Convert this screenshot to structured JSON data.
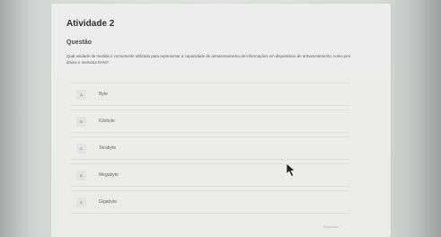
{
  "page": {
    "title": "Atividade 2",
    "section_label": "Questão",
    "question_text": "Qual unidade de medida é comumente utilizada para representar a capacidade de armazenamento de informações em dispositivos de armazenamento, como pen drives e memória RAM?",
    "options": [
      {
        "letter": "A",
        "text": "Byte"
      },
      {
        "letter": "B",
        "text": "Kilobyte"
      },
      {
        "letter": "C",
        "text": "Terabyte"
      },
      {
        "letter": "D",
        "text": "Megabyte"
      },
      {
        "letter": "E",
        "text": "Gigabyte"
      }
    ],
    "footer_label": "Responder"
  },
  "colors": {
    "background": "#dadcda",
    "card": "#ecedec",
    "text": "#3a3a3a",
    "muted": "#666666"
  },
  "icons": {
    "cursor": "mouse-pointer-icon"
  }
}
